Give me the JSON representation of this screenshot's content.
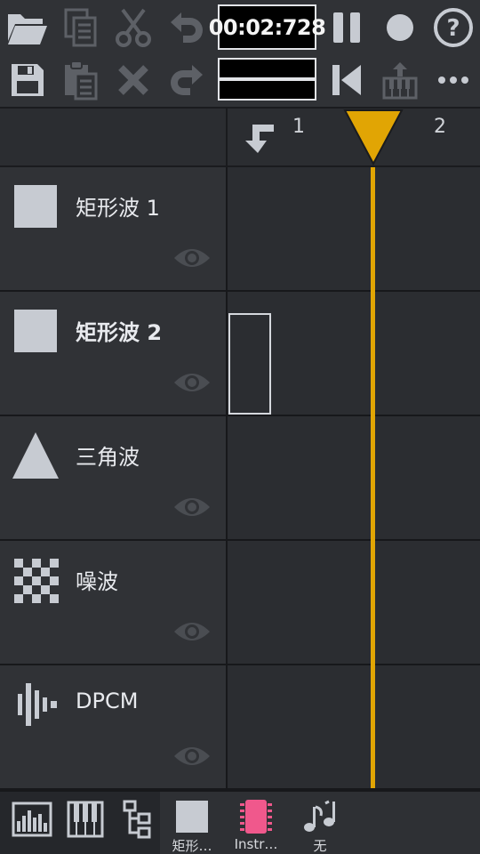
{
  "toolbar": {
    "time": "00:02:728",
    "buttons_row1": [
      "open-icon",
      "copy-icon",
      "cut-icon",
      "undo-icon",
      "pause-icon",
      "record-icon",
      "help-icon"
    ],
    "buttons_row2": [
      "save-icon",
      "paste-icon",
      "delete-icon",
      "redo-icon",
      "rewind-icon",
      "instrument-export-icon",
      "more-icon"
    ]
  },
  "header": {
    "bars": [
      "1",
      "2"
    ]
  },
  "channels": [
    {
      "name": "矩形波 1",
      "icon": "square-wave-icon",
      "bold": false
    },
    {
      "name": "矩形波 2",
      "icon": "square-wave-icon",
      "bold": true
    },
    {
      "name": "三角波",
      "icon": "triangle-wave-icon",
      "bold": false
    },
    {
      "name": "噪波",
      "icon": "noise-icon",
      "bold": false
    },
    {
      "name": "DPCM",
      "icon": "dpcm-icon",
      "bold": false
    }
  ],
  "bottom": {
    "tabs": [
      {
        "label": "矩形…",
        "icon": "square-wave-icon"
      },
      {
        "label": "Instr…",
        "icon": "instrument-chip-icon"
      },
      {
        "label": "无",
        "icon": "music-notes-icon"
      }
    ]
  },
  "colors": {
    "accent": "#e1a504",
    "instrument": "#f0588c",
    "icon": "#c7cbd2"
  }
}
